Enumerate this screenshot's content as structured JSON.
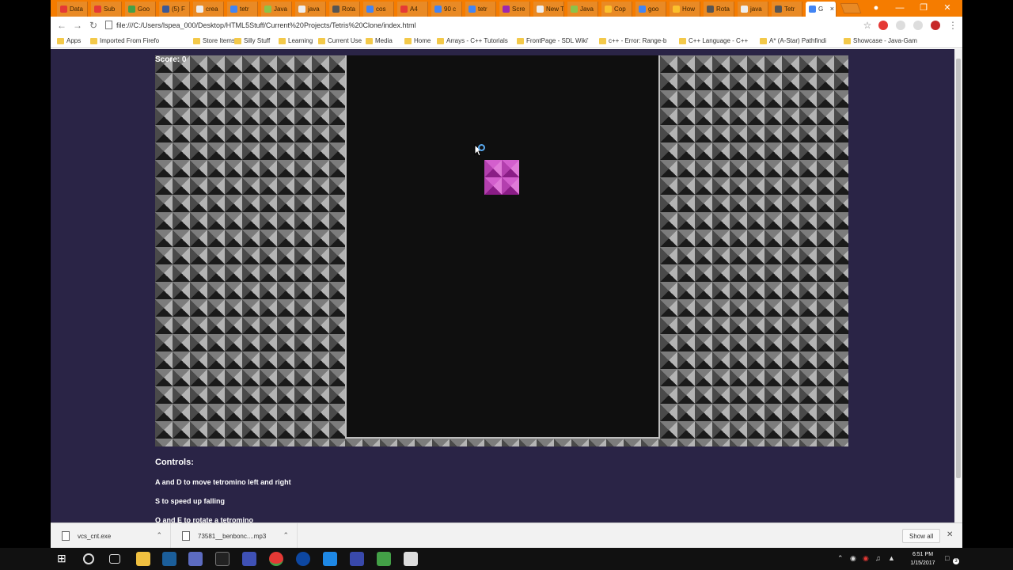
{
  "browser": {
    "tabs": [
      {
        "label": "Data",
        "color": "#e53935"
      },
      {
        "label": "Sub",
        "color": "#e53935"
      },
      {
        "label": "Goo",
        "color": "#43a047"
      },
      {
        "label": "(5) F",
        "color": "#3b5998"
      },
      {
        "label": "crea",
        "color": "#eeeeee"
      },
      {
        "label": "tetr",
        "color": "#4285f4"
      },
      {
        "label": "Java",
        "color": "#8bc34a"
      },
      {
        "label": "java",
        "color": "#eeeeee"
      },
      {
        "label": "Rota",
        "color": "#555555"
      },
      {
        "label": "cos",
        "color": "#4285f4"
      },
      {
        "label": "A4",
        "color": "#e53935"
      },
      {
        "label": "90 c",
        "color": "#4285f4"
      },
      {
        "label": "tetr",
        "color": "#4285f4"
      },
      {
        "label": "Scre",
        "color": "#9c27b0"
      },
      {
        "label": "New Tab",
        "color": "#eeeeee"
      },
      {
        "label": "Java",
        "color": "#8bc34a"
      },
      {
        "label": "Cop",
        "color": "#fbc02d"
      },
      {
        "label": "goo",
        "color": "#4285f4"
      },
      {
        "label": "How",
        "color": "#fbc02d"
      },
      {
        "label": "Rota",
        "color": "#555555"
      },
      {
        "label": "java",
        "color": "#eeeeee"
      },
      {
        "label": "Tetr",
        "color": "#555555"
      },
      {
        "label": "G",
        "color": "#4285f4"
      }
    ],
    "url": "file:///C:/Users/lspea_000/Desktop/HTML5Stuff/Current%20Projects/Tetris%20Clone/index.html",
    "bookmarks": [
      "Apps",
      "Imported From Firefo",
      "Store Items",
      "Silly Stuff",
      "Learning",
      "Current Use",
      "Media",
      "Home",
      "Arrays - C++ Tutorials",
      "FrontPage - SDL Wiki'",
      "c++ - Error: Range-b",
      "C++ Language - C++",
      "A* (A-Star) Pathfindi",
      "Showcase - Java-Gam"
    ]
  },
  "game": {
    "score_text": "Score: 0",
    "piece_color": "#c23bbb",
    "background_color": "#2a2446"
  },
  "controls": {
    "heading": "Controls:",
    "lines": [
      "A and D to move tetromino left and right",
      "S to speed up falling",
      "Q and E to rotate a tetromino"
    ]
  },
  "downloads": {
    "items": [
      "vcs_cnt.exe",
      "73581__benbonc....mp3"
    ],
    "show_all": "Show all"
  },
  "taskbar": {
    "time": "6:51 PM",
    "date": "1/15/2017",
    "notification_count": "3"
  }
}
